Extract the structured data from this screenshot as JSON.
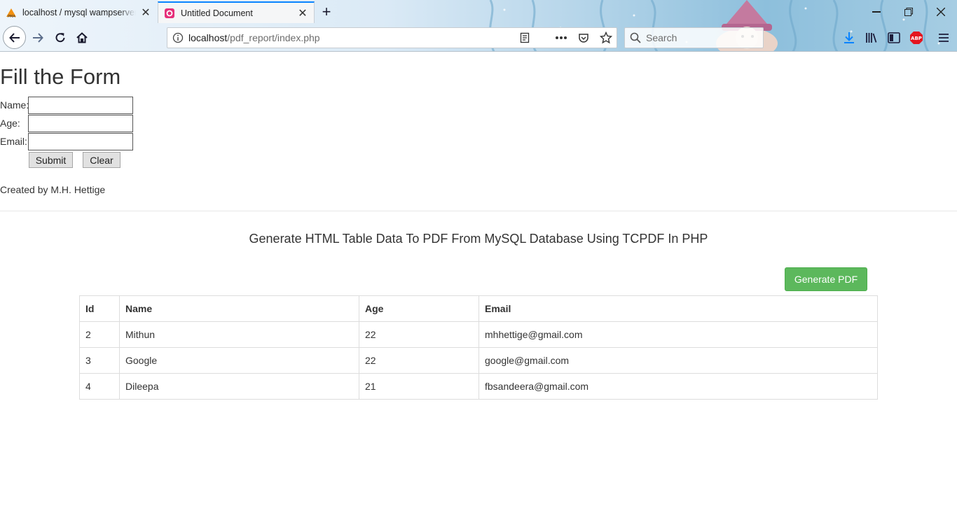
{
  "browser": {
    "tabs": [
      {
        "title": "localhost / mysql wampserver / ...",
        "favicon": "phpmyadmin-icon",
        "active": false
      },
      {
        "title": "Untitled Document",
        "favicon": "page-icon",
        "active": true
      }
    ],
    "url_host": "localhost",
    "url_path": "/pdf_report/index.php",
    "search_placeholder": "Search",
    "toolbar_icons": [
      "download-icon",
      "library-icon",
      "sidebar-icon",
      "adblock-icon",
      "menu-icon"
    ],
    "accent_color": "#0a84ff"
  },
  "form": {
    "title": "Fill the Form",
    "fields": [
      {
        "label": "Name:",
        "value": ""
      },
      {
        "label": "Age:",
        "value": ""
      },
      {
        "label": "Email:",
        "value": ""
      }
    ],
    "submit_label": "Submit",
    "clear_label": "Clear",
    "credit": "Created by M.H. Hettige"
  },
  "report": {
    "title": "Generate HTML Table Data To PDF From MySQL Database Using TCPDF In PHP",
    "generate_label": "Generate PDF",
    "generate_color": "#5cb85c",
    "columns": [
      "Id",
      "Name",
      "Age",
      "Email"
    ],
    "rows": [
      [
        "2",
        "Mithun",
        "22",
        "mhhettige@gmail.com"
      ],
      [
        "3",
        "Google",
        "22",
        "google@gmail.com"
      ],
      [
        "4",
        "Dileepa",
        "21",
        "fbsandeera@gmail.com"
      ]
    ]
  }
}
